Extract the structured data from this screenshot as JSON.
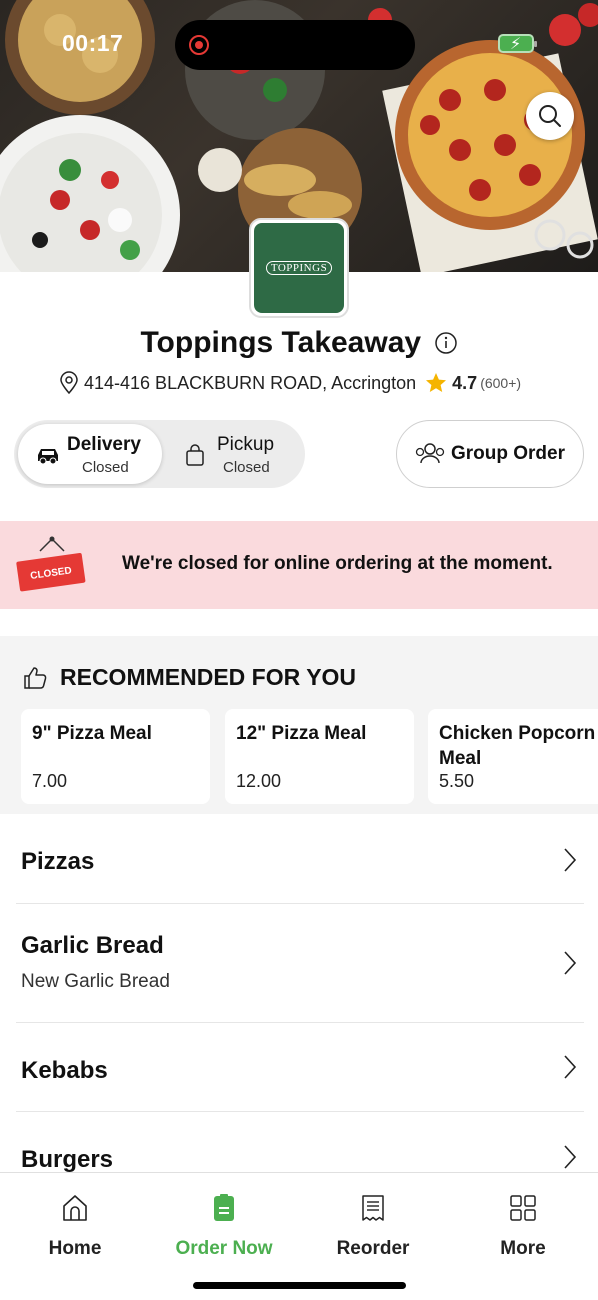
{
  "status": {
    "time": "00:17"
  },
  "restaurant": {
    "logo_text": "TOPPINGS",
    "name": "Toppings Takeaway",
    "address": "414-416 BLACKBURN ROAD, Accrington",
    "rating": "4.7",
    "rating_count": "(600+)"
  },
  "modes": {
    "delivery": {
      "label": "Delivery",
      "status": "Closed",
      "selected": true
    },
    "pickup": {
      "label": "Pickup",
      "status": "Closed",
      "selected": false
    }
  },
  "group_order_label": "Group Order",
  "closed_banner": {
    "sign_text": "CLOSED",
    "message": "We're closed for online ordering at the moment."
  },
  "recommended": {
    "title": "RECOMMENDED FOR YOU",
    "items": [
      {
        "name": "9\" Pizza Meal",
        "price": "7.00"
      },
      {
        "name": "12\" Pizza Meal",
        "price": "12.00"
      },
      {
        "name": "Chicken Popcorn Meal",
        "price": "5.50"
      }
    ]
  },
  "categories": [
    {
      "name": "Pizzas",
      "subtitle": ""
    },
    {
      "name": "Garlic Bread",
      "subtitle": "New Garlic Bread"
    },
    {
      "name": "Kebabs",
      "subtitle": ""
    },
    {
      "name": "Burgers",
      "subtitle": ""
    }
  ],
  "tabbar": [
    {
      "label": "Home",
      "icon": "home-icon",
      "active": false
    },
    {
      "label": "Order Now",
      "icon": "order-icon",
      "active": true
    },
    {
      "label": "Reorder",
      "icon": "receipt-icon",
      "active": false
    },
    {
      "label": "More",
      "icon": "grid-icon",
      "active": false
    }
  ],
  "colors": {
    "accent": "#4caf50",
    "closed_banner": "#fadadd",
    "logo_green": "#2e6a45",
    "star": "#f5b400"
  }
}
